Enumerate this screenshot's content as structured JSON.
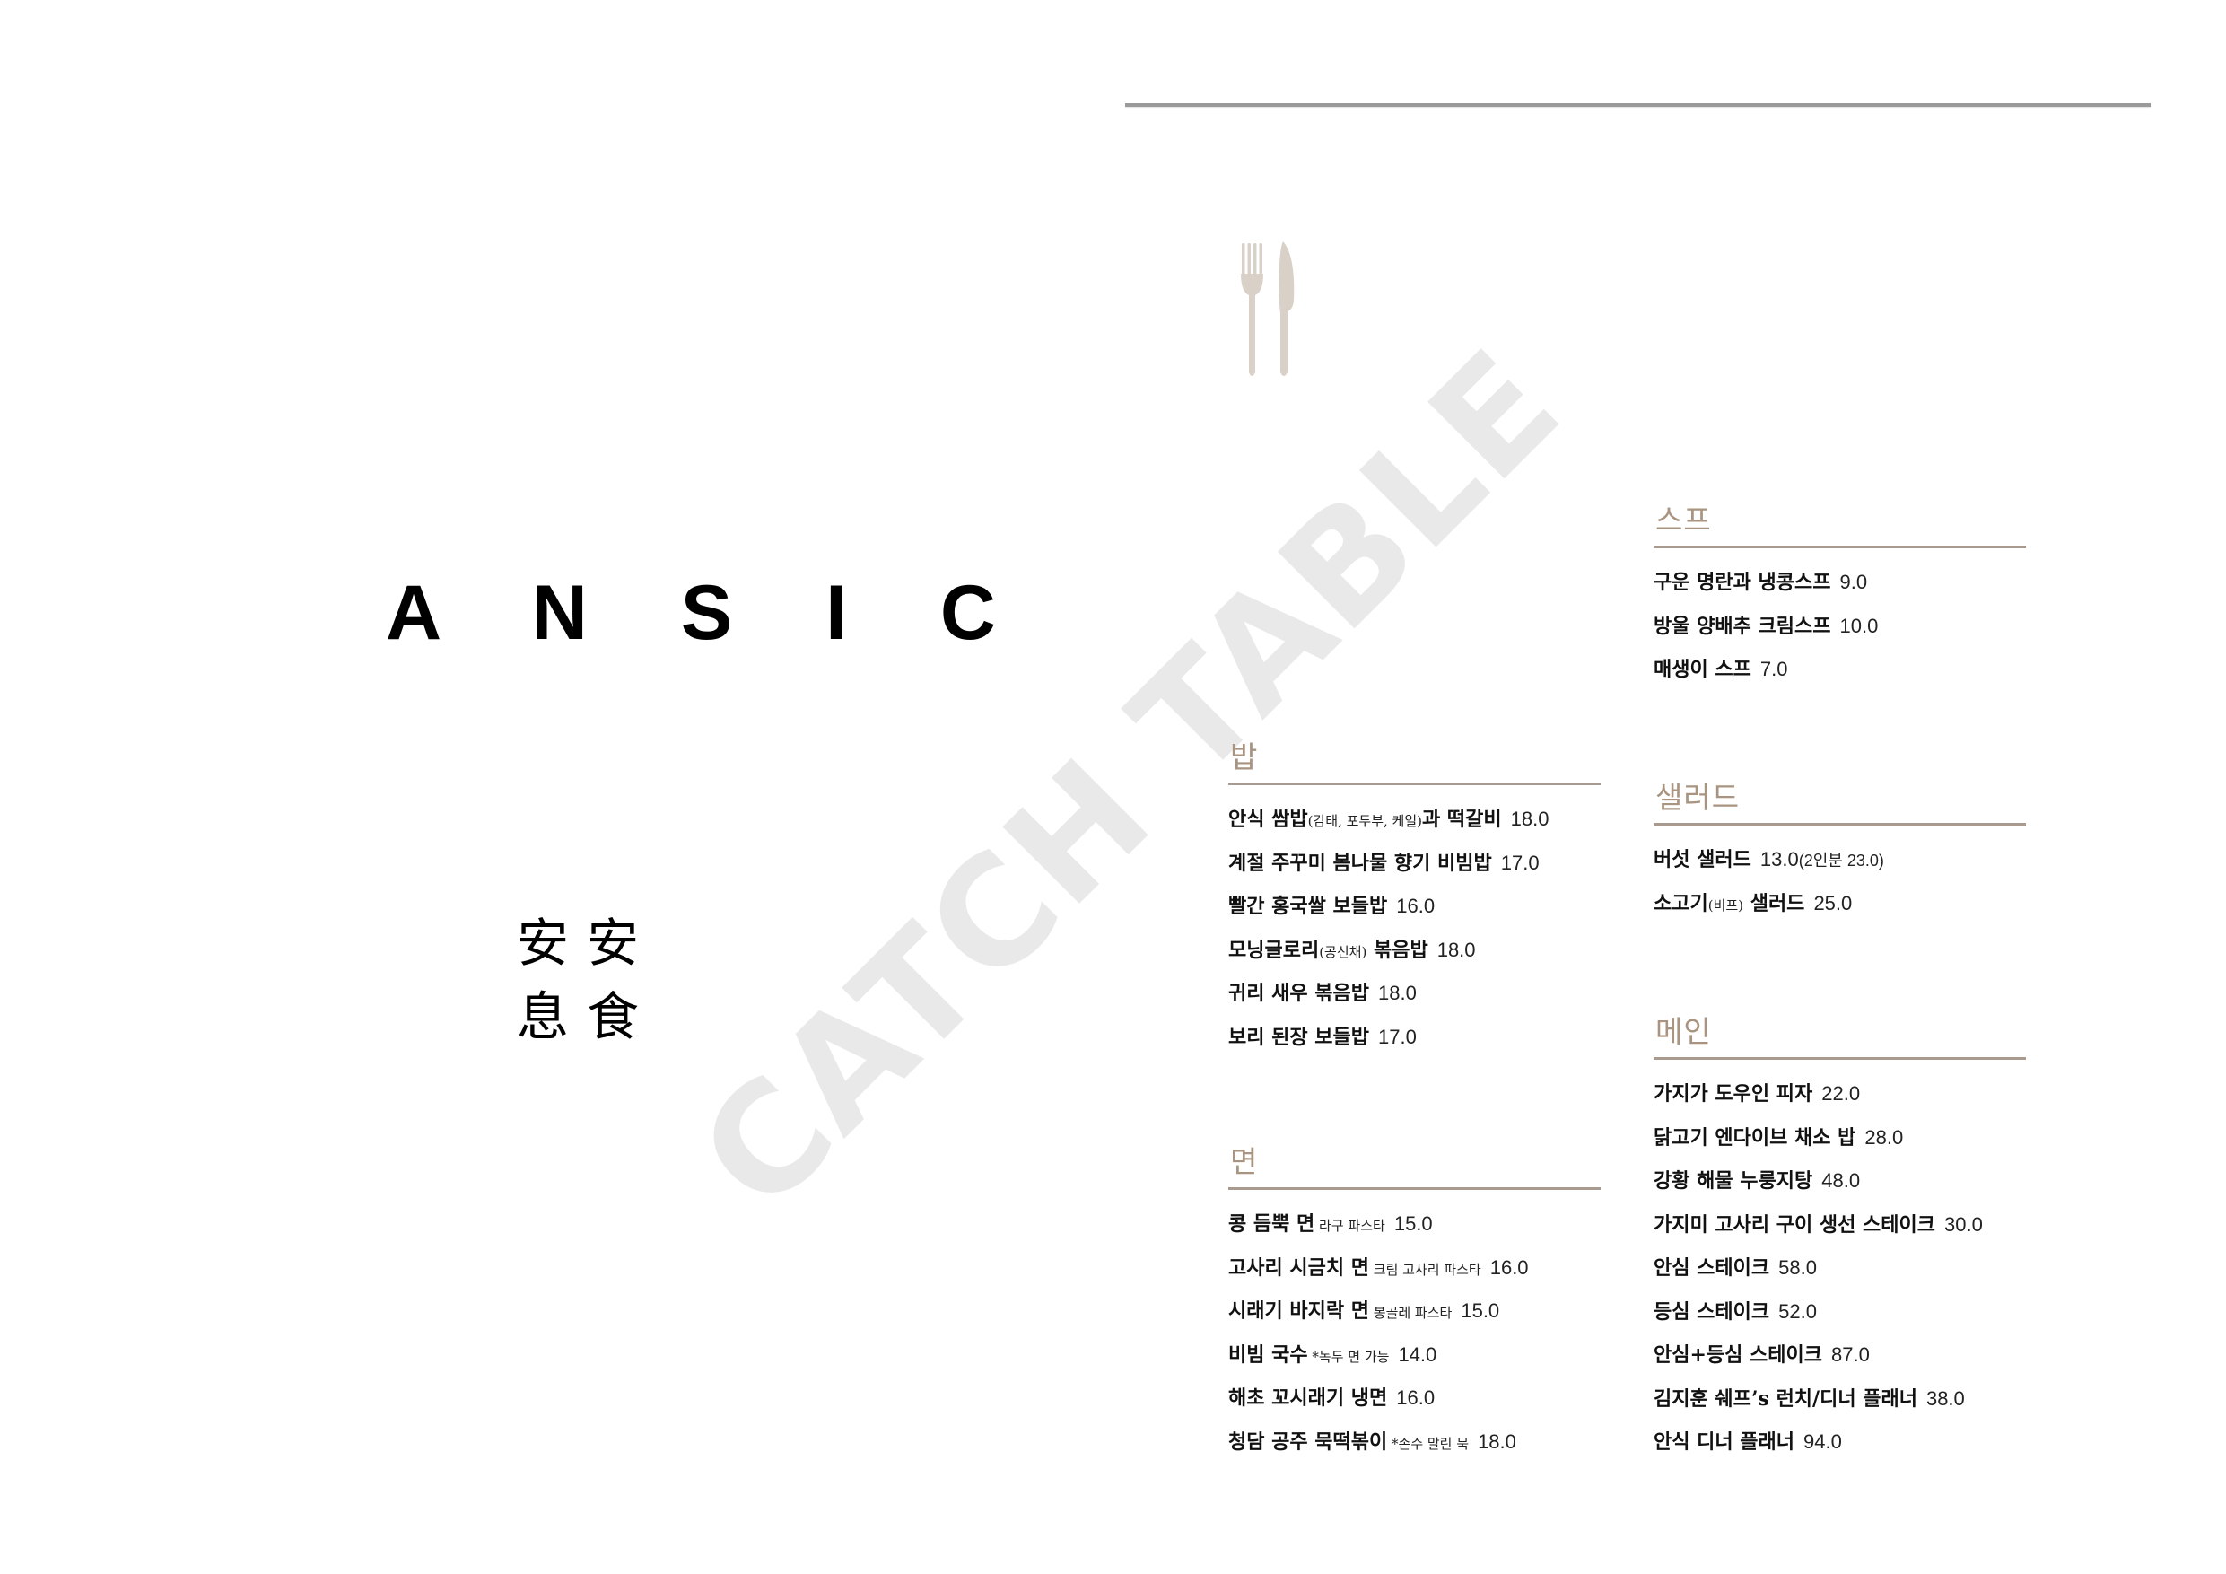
{
  "brand": {
    "name": "A N S I C",
    "hanja": [
      "安",
      "安",
      "息",
      "食"
    ]
  },
  "icons": {
    "cutlery": "fork-knife-icon"
  },
  "colors": {
    "accent": "#a89480",
    "rule": "#a89a8e",
    "top_rule": "#9a9a9a",
    "watermark": "#e9e9e9"
  },
  "watermark": "CATCH TABLE",
  "menu": {
    "rice": {
      "title": "밥",
      "items": [
        {
          "name": "안식 쌈밥",
          "note": "(감태, 포두부, 케일)",
          "name2": "과 떡갈비",
          "price": "18.0"
        },
        {
          "name": "계절 주꾸미 봄나물 향기 비빔밥",
          "note": "",
          "name2": "",
          "price": "17.0"
        },
        {
          "name": "빨간 홍국쌀 보들밥",
          "note": "",
          "name2": "",
          "price": "16.0"
        },
        {
          "name": "모닝글로리",
          "note": "(공신채)",
          "name2": " 볶음밥",
          "price": "18.0"
        },
        {
          "name": "귀리 새우 볶음밥",
          "note": "",
          "name2": "",
          "price": "18.0"
        },
        {
          "name": "보리 된장 보들밥",
          "note": "",
          "name2": "",
          "price": "17.0"
        }
      ]
    },
    "noodles": {
      "title": "면",
      "items": [
        {
          "name": "콩 듬뿍 면",
          "note": " 라구 파스타",
          "name2": "",
          "price": "15.0"
        },
        {
          "name": "고사리 시금치 면",
          "note": " 크림 고사리 파스타",
          "name2": "",
          "price": "16.0"
        },
        {
          "name": "시래기 바지락 면",
          "note": " 봉골레 파스타",
          "name2": "",
          "price": "15.0"
        },
        {
          "name": "비빔 국수",
          "note": " *녹두 면 가능",
          "name2": "",
          "price": "14.0"
        },
        {
          "name": "해초 꼬시래기 냉면",
          "note": "",
          "name2": "",
          "price": "16.0"
        },
        {
          "name": "청담 공주 묵떡볶이",
          "note": " *손수 말린 묵",
          "name2": "",
          "price": "18.0"
        }
      ]
    },
    "soup": {
      "title": "스프",
      "items": [
        {
          "name": "구운 명란과 냉콩스프",
          "note": "",
          "name2": "",
          "price": "9.0"
        },
        {
          "name": "방울 양배추 크림스프",
          "note": "",
          "name2": "",
          "price": "10.0"
        },
        {
          "name": "매생이 스프",
          "note": "",
          "name2": "",
          "price": "7.0"
        }
      ]
    },
    "salad": {
      "title": "샐러드",
      "items": [
        {
          "name": "버섯 샐러드",
          "note": "",
          "name2": "",
          "price": "13.0",
          "price_note": "(2인분 23.0)"
        },
        {
          "name": "소고기",
          "note": "(비프)",
          "name2": " 샐러드",
          "price": "25.0"
        }
      ]
    },
    "main": {
      "title": "메인",
      "items": [
        {
          "name": "가지가 도우인 피자",
          "note": "",
          "name2": "",
          "price": "22.0"
        },
        {
          "name": "닭고기 엔다이브 채소 밥",
          "note": "",
          "name2": "",
          "price": "28.0"
        },
        {
          "name": "강황 해물 누룽지탕",
          "note": "",
          "name2": "",
          "price": "48.0"
        },
        {
          "name": "가지미 고사리 구이 생선 스테이크",
          "note": "",
          "name2": "",
          "price": "30.0"
        },
        {
          "name": "안심 스테이크",
          "note": "",
          "name2": "",
          "price": "58.0"
        },
        {
          "name": "등심 스테이크",
          "note": "",
          "name2": "",
          "price": "52.0"
        },
        {
          "name": "안심+등심 스테이크",
          "note": "",
          "name2": "",
          "price": "87.0"
        },
        {
          "name": "김지훈 쉐프’s 런치/디너 플래너",
          "note": "",
          "name2": "",
          "price": "38.0"
        },
        {
          "name": "안식 디너 플래너",
          "note": "",
          "name2": "",
          "price": "94.0"
        }
      ]
    }
  }
}
